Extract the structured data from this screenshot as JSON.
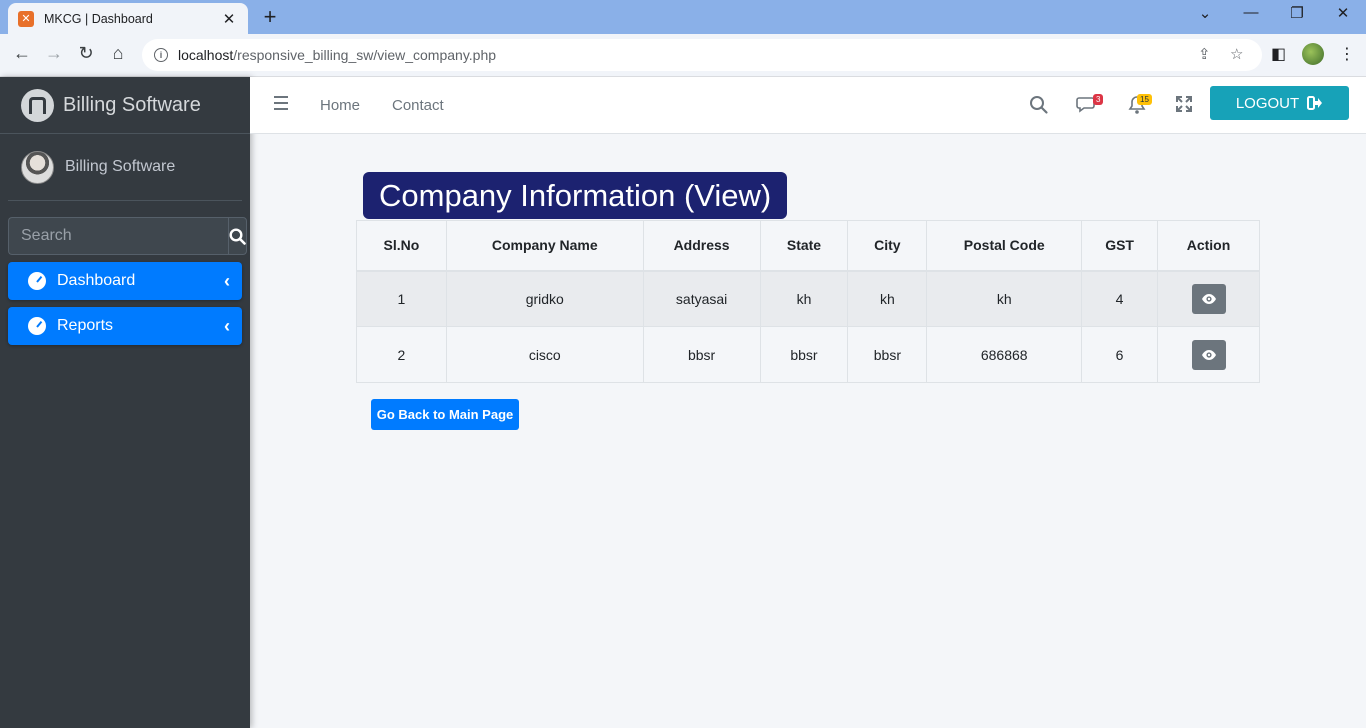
{
  "browser": {
    "tab_title": "MKCG | Dashboard",
    "tab_close": "✕",
    "new_tab": "+",
    "url_host": "localhost",
    "url_path": "/responsive_billing_sw/view_company.php",
    "window_controls": [
      "⌄",
      "—",
      "❐",
      "✕"
    ]
  },
  "sidebar": {
    "brand": "Billing Software",
    "user_name": "Billing Software",
    "search_placeholder": "Search",
    "menu": [
      {
        "label": "Dashboard",
        "icon": "tachometer-icon"
      },
      {
        "label": "Reports",
        "icon": "tachometer-icon"
      }
    ]
  },
  "navbar": {
    "links": [
      "Home",
      "Contact"
    ],
    "messages_count": "3",
    "notifications_count": "15",
    "logout_label": "LOGOUT"
  },
  "content": {
    "title": "Company Information (View)",
    "table": {
      "headers": [
        "Sl.No",
        "Company Name",
        "Address",
        "State",
        "City",
        "Postal Code",
        "GST",
        "Action"
      ],
      "rows": [
        [
          "1",
          "gridko",
          "satyasai",
          "kh",
          "kh",
          "kh",
          "4"
        ],
        [
          "2",
          "cisco",
          "bbsr",
          "bbsr",
          "bbsr",
          "686868",
          "6"
        ]
      ]
    },
    "back_button": "Go Back to Main Page"
  },
  "colors": {
    "sidebar_bg": "#343a40",
    "primary": "#007bff",
    "title_bg": "#1c2270",
    "logout_bg": "#17a2b8",
    "view_btn": "#6c757d"
  }
}
